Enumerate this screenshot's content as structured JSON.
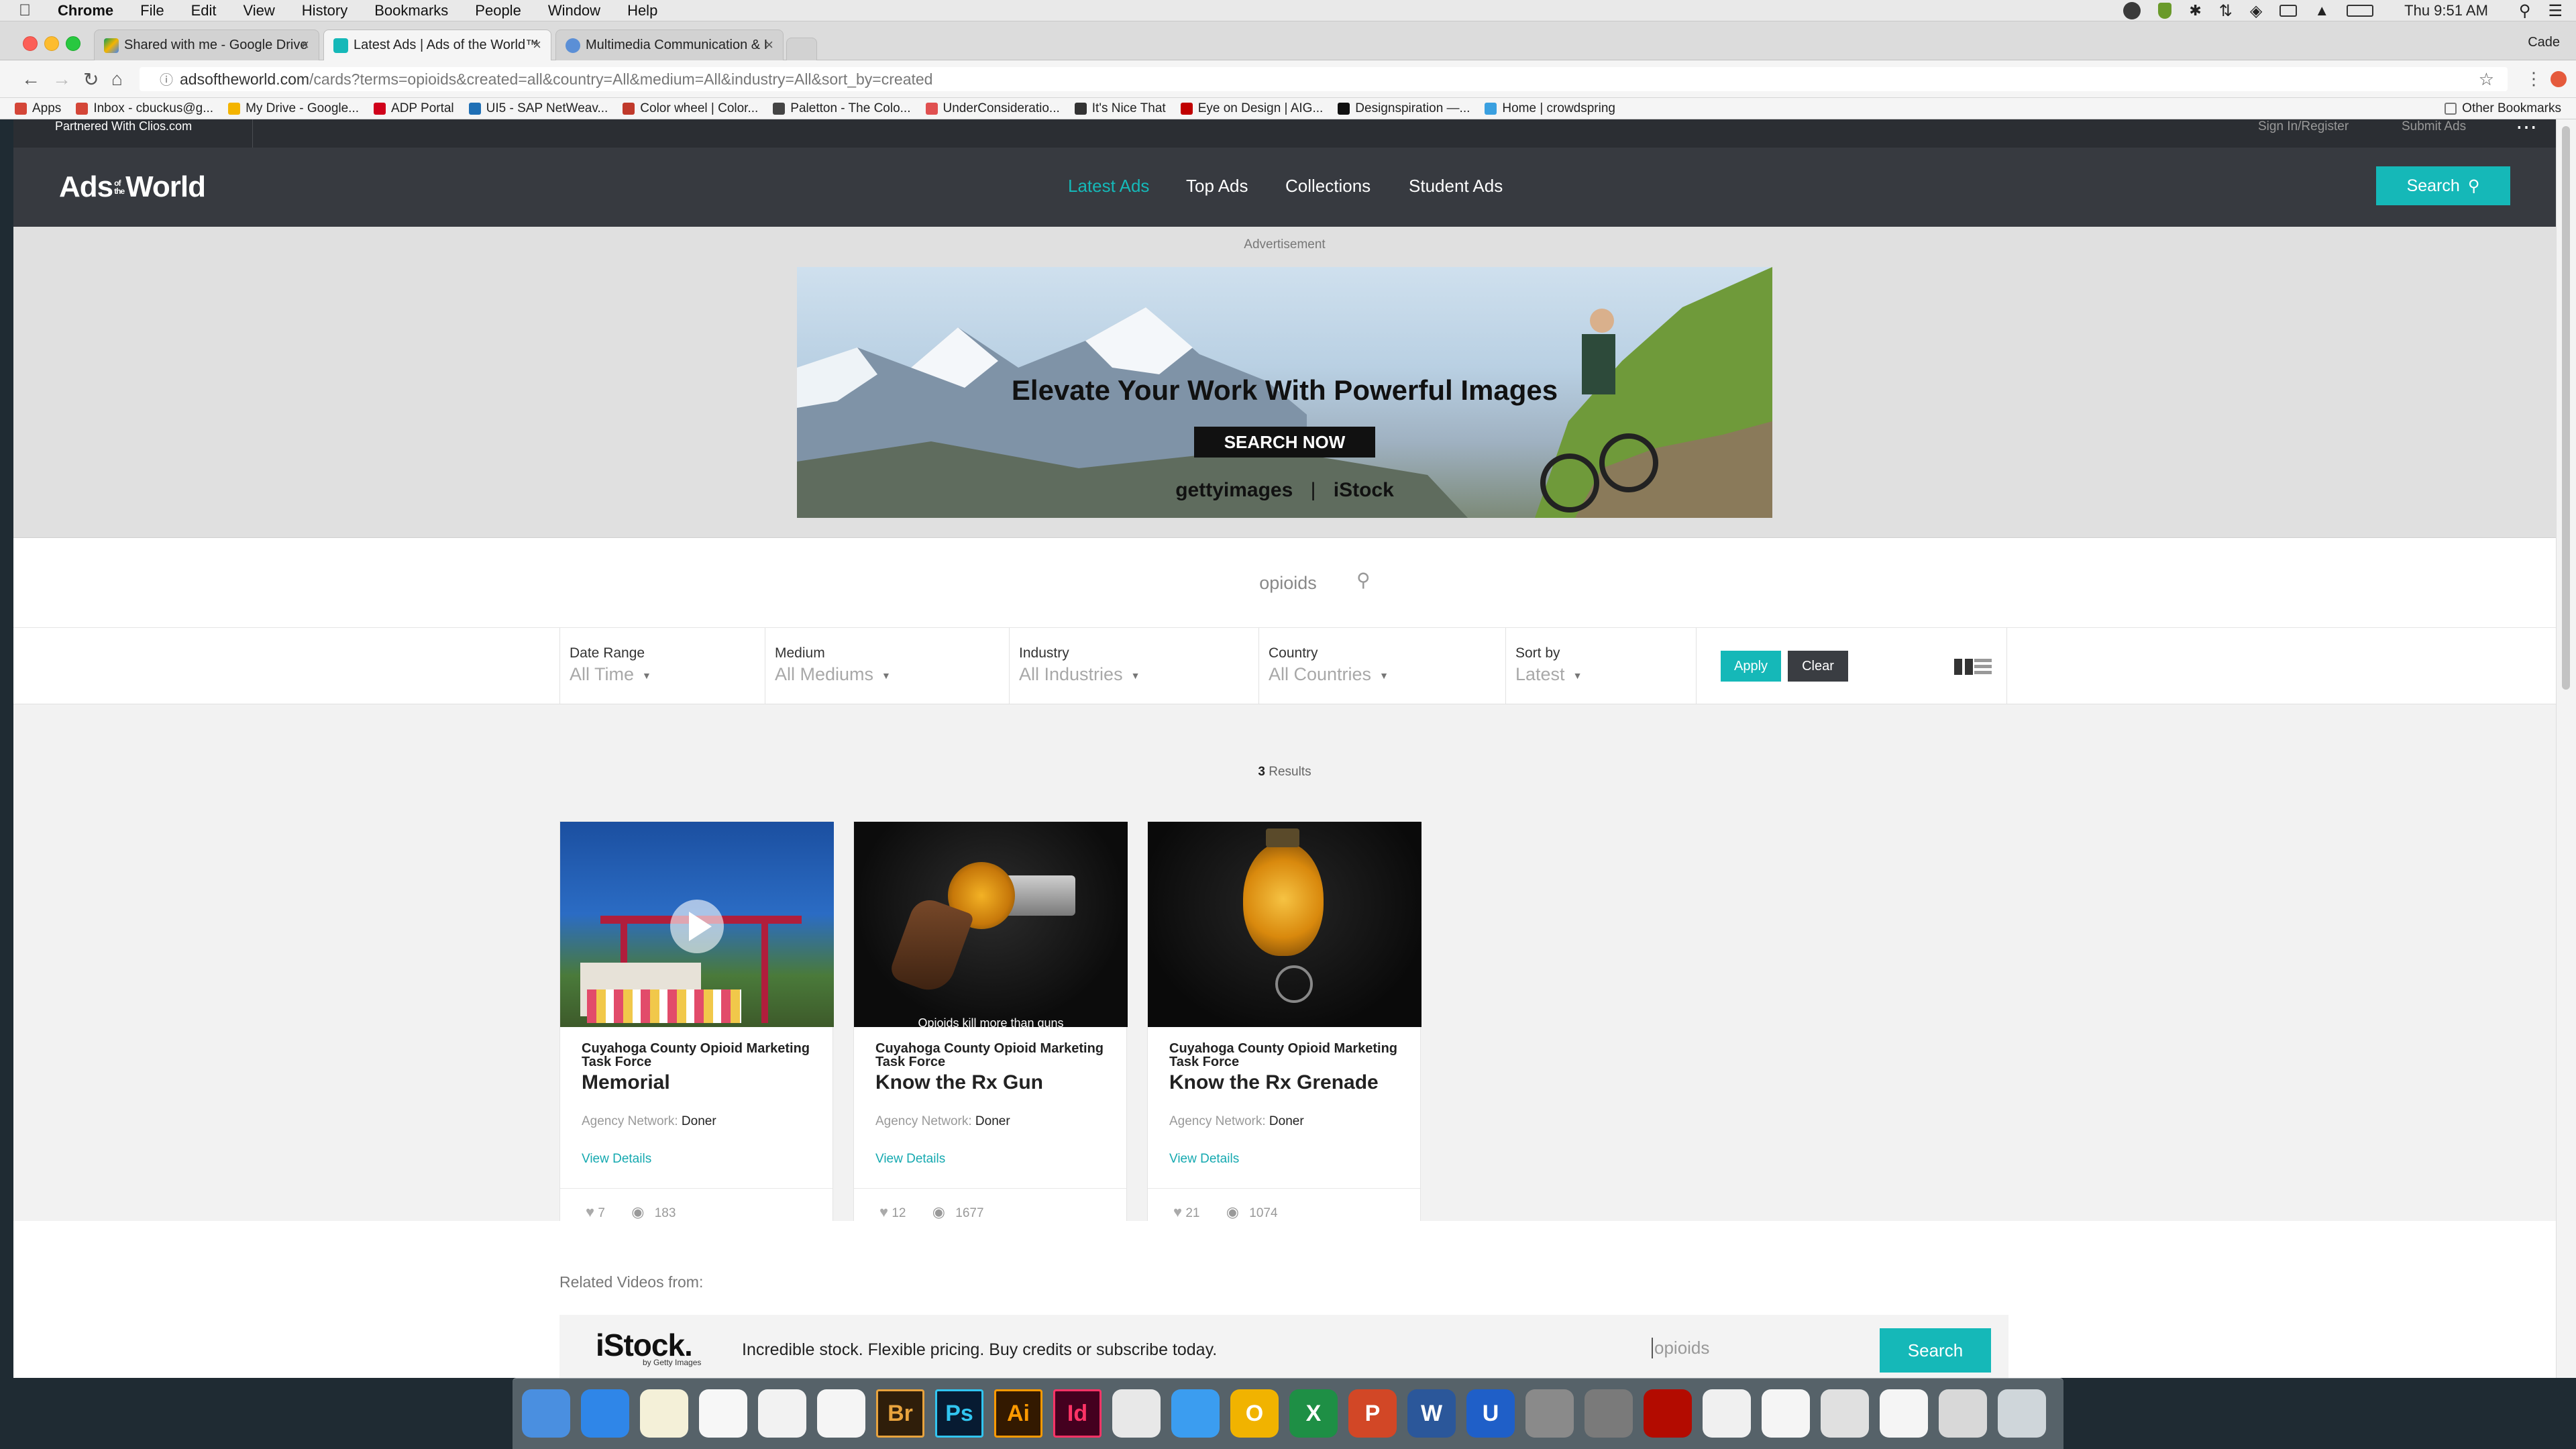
{
  "menubar": {
    "app": "Chrome",
    "menus": [
      "File",
      "Edit",
      "View",
      "History",
      "Bookmarks",
      "People",
      "Window",
      "Help"
    ],
    "clock": "Thu 9:51 AM",
    "apple_icon": "apple-icon"
  },
  "tabs": [
    {
      "label": "Shared with me - Google Drive",
      "icon": "google-drive-icon"
    },
    {
      "label": "Latest Ads | Ads of the World™",
      "icon": "adsoftheworld-icon"
    },
    {
      "label": "Multimedia Communication & I",
      "icon": "lightbulb-icon"
    }
  ],
  "profile": "Cade",
  "address": {
    "domain": "adsoftheworld.com",
    "path": "/cards?terms=opioids&created=all&country=All&medium=All&industry=All&sort_by=created"
  },
  "bookmarks": [
    {
      "label": "Apps",
      "color": "#d44638"
    },
    {
      "label": "Inbox - cbuckus@g...",
      "color": "#d44638"
    },
    {
      "label": "My Drive - Google...",
      "color": "#f4b400"
    },
    {
      "label": "ADP Portal",
      "color": "#d0021b"
    },
    {
      "label": "UI5 - SAP NetWeav...",
      "color": "#1f6fb5"
    },
    {
      "label": "Color wheel | Color...",
      "color": "#c0392b"
    },
    {
      "label": "Paletton - The Colo...",
      "color": "#444444"
    },
    {
      "label": "UnderConsideratio...",
      "color": "#e05050"
    },
    {
      "label": "It's Nice That",
      "color": "#333333"
    },
    {
      "label": "Eye on Design | AIG...",
      "color": "#c00000"
    },
    {
      "label": "Designspiration —...",
      "color": "#111111"
    },
    {
      "label": "Home | crowdspring",
      "color": "#3aa0e0"
    }
  ],
  "other_bookmarks": "Other Bookmarks",
  "site": {
    "partner": "Partnered With Clios.com",
    "sign_in": "Sign In/Register",
    "submit": "Submit Ads",
    "more_icon": "more-dots-icon",
    "logo": "AdsoftheWorld",
    "logo_main": "Ads",
    "logo_of": "of",
    "logo_the": "the",
    "logo_world": "World",
    "nav": [
      "Latest Ads",
      "Top Ads",
      "Collections",
      "Student Ads"
    ],
    "search_button": "Search",
    "accent": "#15b8b8"
  },
  "ad": {
    "label": "Advertisement",
    "headline": "Elevate Your Work With Powerful Images",
    "cta": "SEARCH NOW",
    "brand_getty": "gettyimages",
    "brand_istock": "iStock"
  },
  "search": {
    "value": "opioids"
  },
  "filters": [
    {
      "label": "Date Range",
      "value": "All Time"
    },
    {
      "label": "Medium",
      "value": "All Mediums"
    },
    {
      "label": "Industry",
      "value": "All Industries"
    },
    {
      "label": "Country",
      "value": "All Countries"
    },
    {
      "label": "Sort by",
      "value": "Latest"
    }
  ],
  "filter_actions": {
    "apply": "Apply",
    "clear": "Clear"
  },
  "results": {
    "count": "3",
    "label": "Results"
  },
  "cards": [
    {
      "client": "Cuyahoga County Opioid Marketing Task Force",
      "title": "Memorial",
      "agency_label": "Agency Network:",
      "agency": "Doner",
      "details": "View Details",
      "likes": "7",
      "views": "183",
      "has_video": true
    },
    {
      "client": "Cuyahoga County Opioid Marketing Task Force",
      "title": "Know the Rx Gun",
      "agency_label": "Agency Network:",
      "agency": "Doner",
      "details": "View Details",
      "likes": "12",
      "views": "1677",
      "caption": "Opioids kill more than guns"
    },
    {
      "client": "Cuyahoga County Opioid Marketing Task Force",
      "title": "Know the Rx Grenade",
      "agency_label": "Agency Network:",
      "agency": "Doner",
      "details": "View Details",
      "likes": "21",
      "views": "1074"
    }
  ],
  "related": {
    "heading": "Related Videos from:",
    "istock_logo": "iStock.",
    "istock_sub": "by Getty Images",
    "tagline": "Incredible stock. Flexible pricing. Buy credits or subscribe today.",
    "search_value": "opioids",
    "search_button": "Search"
  },
  "dock": [
    {
      "name": "finder-icon",
      "label": "",
      "color": "#4a8fe0"
    },
    {
      "name": "safari-icon",
      "label": "",
      "color": "#2f86e8"
    },
    {
      "name": "notes-icon",
      "label": "",
      "color": "#f4f0d8"
    },
    {
      "name": "reminders-icon",
      "label": "",
      "color": "#f7f7f7"
    },
    {
      "name": "photos-icon",
      "label": "",
      "color": "#f2f2f2"
    },
    {
      "name": "itunes-icon",
      "label": "",
      "color": "#f5f5f5"
    },
    {
      "name": "bridge-icon",
      "label": "Br",
      "color": "#2f1e0a"
    },
    {
      "name": "photoshop-icon",
      "label": "Ps",
      "color": "#071b32"
    },
    {
      "name": "illustrator-icon",
      "label": "Ai",
      "color": "#331900"
    },
    {
      "name": "indesign-icon",
      "label": "Id",
      "color": "#44001f"
    },
    {
      "name": "chrome-icon",
      "label": "",
      "color": "#e8e8e8"
    },
    {
      "name": "messages-icon",
      "label": "",
      "color": "#3b9df0"
    },
    {
      "name": "outlook-icon",
      "label": "O",
      "color": "#f1b300"
    },
    {
      "name": "excel-icon",
      "label": "X",
      "color": "#1e8f45"
    },
    {
      "name": "powerpoint-icon",
      "label": "P",
      "color": "#d24726"
    },
    {
      "name": "word-icon",
      "label": "W",
      "color": "#2b579a"
    },
    {
      "name": "ultra-icon",
      "label": "U",
      "color": "#1f5fc8"
    },
    {
      "name": "calculator-icon",
      "label": "",
      "color": "#8a8a8a"
    },
    {
      "name": "system-preferences-icon",
      "label": "",
      "color": "#7a7a7a"
    },
    {
      "name": "acrobat-icon",
      "label": "",
      "color": "#b30b00"
    },
    {
      "name": "document-icon",
      "label": "",
      "color": "#f0f0f0"
    },
    {
      "name": "psd-file-icon",
      "label": "",
      "color": "#f5f5f5"
    },
    {
      "name": "screenshot-icon",
      "label": "",
      "color": "#e0e0e0"
    },
    {
      "name": "indd-file-icon",
      "label": "",
      "color": "#f5f5f5"
    },
    {
      "name": "preview-icon",
      "label": "",
      "color": "#d8d8d8"
    },
    {
      "name": "trash-icon",
      "label": "",
      "color": "#cfd6da"
    }
  ]
}
